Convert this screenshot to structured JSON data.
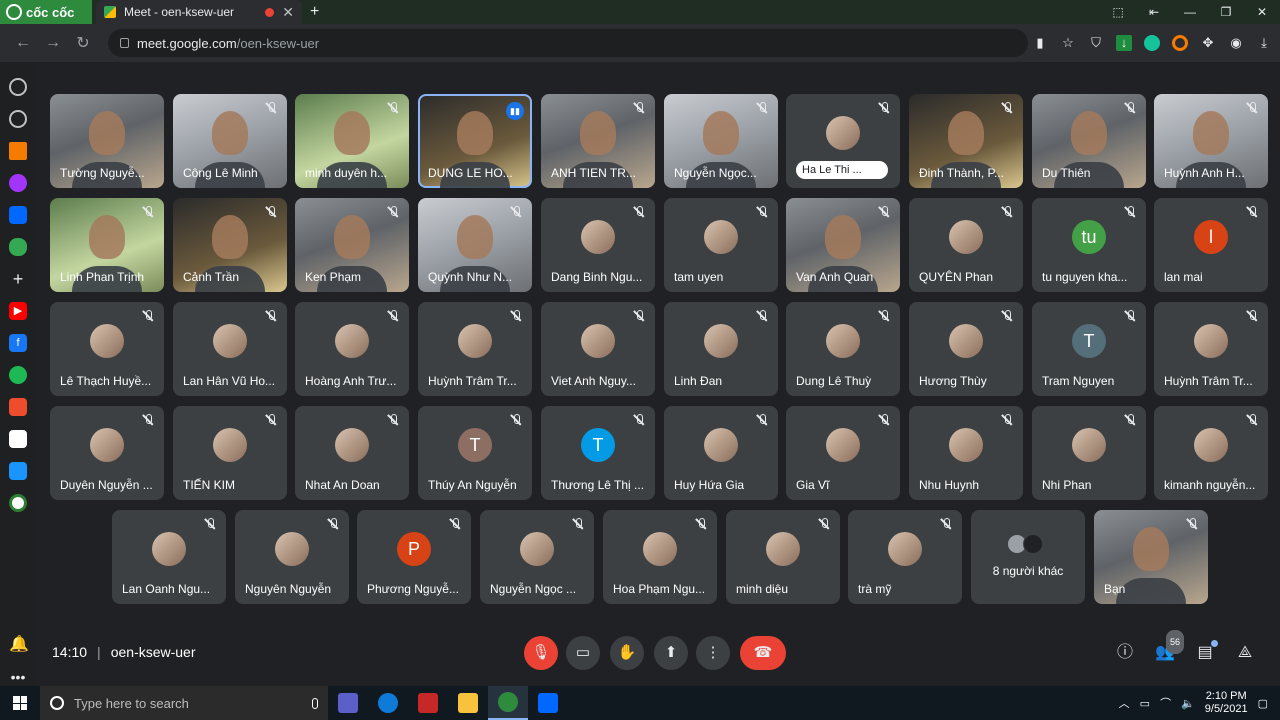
{
  "browser": {
    "brand": "cốc cốc",
    "tab_title": "Meet - oen-ksew-uer",
    "url_host": "meet.google.com",
    "url_path": "/oen-ksew-uer"
  },
  "tiles": [
    {
      "name": "Tường Nguyễ...",
      "kind": "video"
    },
    {
      "name": "Công Lê Minh",
      "kind": "video"
    },
    {
      "name": "minh duyên h...",
      "kind": "video"
    },
    {
      "name": "DUNG LE HO...",
      "kind": "video"
    },
    {
      "name": "ANH TIEN TR...",
      "kind": "video"
    },
    {
      "name": "Nguyễn Ngọc...",
      "kind": "video"
    },
    {
      "name": "Ha Le Thi ...",
      "kind": "hand"
    },
    {
      "name": "Đinh Thành, P...",
      "kind": "video"
    },
    {
      "name": "Du Thiên",
      "kind": "video"
    },
    {
      "name": "Huỳnh Anh H...",
      "kind": "video"
    },
    {
      "name": "Linh Phan Trịnh",
      "kind": "video"
    },
    {
      "name": "Cảnh Trần",
      "kind": "video"
    },
    {
      "name": "Ken Phạm",
      "kind": "video"
    },
    {
      "name": "Quỳnh Như N...",
      "kind": "video"
    },
    {
      "name": "Dang Binh Ngu...",
      "kind": "avatar"
    },
    {
      "name": "tam uyen",
      "kind": "avatar"
    },
    {
      "name": "Van Anh Quan",
      "kind": "video"
    },
    {
      "name": "QUYÊN Phan",
      "kind": "avatar"
    },
    {
      "name": "tu nguyen kha...",
      "kind": "avatar",
      "initial": "tu",
      "color": "#43a047"
    },
    {
      "name": "lan mai",
      "kind": "avatar",
      "initial": "l",
      "color": "#d84315"
    },
    {
      "name": "Lê Thạch Huyề...",
      "kind": "avatar"
    },
    {
      "name": "Lan Hân Vũ Ho...",
      "kind": "avatar"
    },
    {
      "name": "Hoàng Anh Trư...",
      "kind": "avatar"
    },
    {
      "name": "Huỳnh Trâm Tr...",
      "kind": "avatar"
    },
    {
      "name": "Viet Anh Nguy...",
      "kind": "avatar"
    },
    {
      "name": "Linh Đan",
      "kind": "avatar"
    },
    {
      "name": "Dung Lê Thuỳ",
      "kind": "avatar"
    },
    {
      "name": "Hương Thùy",
      "kind": "avatar"
    },
    {
      "name": "Tram Nguyen",
      "kind": "avatar",
      "initial": "T",
      "color": "#546e7a"
    },
    {
      "name": "Huỳnh Trâm Tr...",
      "kind": "avatar"
    },
    {
      "name": "Duyên Nguyễn ...",
      "kind": "avatar"
    },
    {
      "name": "TIẾN KIM",
      "kind": "avatar"
    },
    {
      "name": "Nhat An Doan",
      "kind": "avatar"
    },
    {
      "name": "Thúy An Nguyễn",
      "kind": "avatar",
      "initial": "T",
      "color": "#8d6e63"
    },
    {
      "name": "Thương Lê Thị ...",
      "kind": "avatar",
      "initial": "T",
      "color": "#039be5"
    },
    {
      "name": "Huy Hứa Gia",
      "kind": "avatar"
    },
    {
      "name": "Gia Vĩ",
      "kind": "avatar"
    },
    {
      "name": "Nhu Huynh",
      "kind": "avatar"
    },
    {
      "name": "Nhi Phan",
      "kind": "avatar"
    },
    {
      "name": "kimanh nguyễn...",
      "kind": "avatar"
    },
    {
      "name": "Lan Oanh Ngu...",
      "kind": "avatar"
    },
    {
      "name": "Nguyên Nguyễn",
      "kind": "avatar"
    },
    {
      "name": "Phương Nguyễ...",
      "kind": "avatar",
      "initial": "P",
      "color": "#d84315"
    },
    {
      "name": "Nguyễn Ngọc ...",
      "kind": "avatar"
    },
    {
      "name": "Hoa Phạm Ngu...",
      "kind": "avatar"
    },
    {
      "name": "minh diệu",
      "kind": "avatar"
    },
    {
      "name": "trà mỹ",
      "kind": "avatar"
    },
    {
      "name": "8 người khác",
      "kind": "others"
    },
    {
      "name": "Bạn",
      "kind": "self"
    }
  ],
  "bottom": {
    "time": "14:10",
    "meeting_code": "oen-ksew-uer",
    "participant_count": "56"
  },
  "taskbar": {
    "search_placeholder": "Type here to search",
    "clock_time": "2:10 PM",
    "clock_date": "9/5/2021"
  }
}
